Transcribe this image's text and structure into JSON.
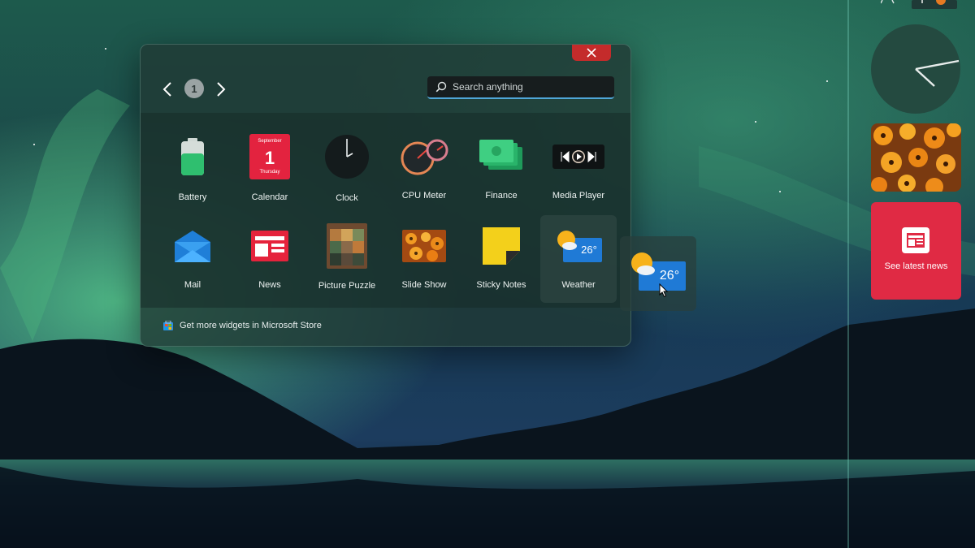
{
  "gallery": {
    "page_number": "1",
    "search_placeholder": "Search anything",
    "store_link": "Get more widgets in Microsoft Store",
    "widgets": [
      {
        "name": "Battery"
      },
      {
        "name": "Calendar",
        "month": "September",
        "day": "1",
        "weekday": "Thursday"
      },
      {
        "name": "Clock"
      },
      {
        "name": "CPU Meter"
      },
      {
        "name": "Finance"
      },
      {
        "name": "Media Player"
      },
      {
        "name": "Mail"
      },
      {
        "name": "News"
      },
      {
        "name": "Picture Puzzle"
      },
      {
        "name": "Slide Show"
      },
      {
        "name": "Sticky Notes"
      },
      {
        "name": "Weather",
        "temperature": "26°"
      }
    ]
  },
  "dragging": {
    "temperature": "26°"
  },
  "sidebar": {
    "news_label": "See latest news"
  },
  "colors": {
    "accent_red": "#e02a44",
    "close_red": "#c42b2b",
    "search_underline": "#4fa6d8",
    "aurora_green": "#3fa37a"
  },
  "icons": [
    "chevron-left-icon",
    "chevron-right-icon",
    "search-icon",
    "close-icon",
    "store-icon",
    "cursor-arrow-icon"
  ]
}
